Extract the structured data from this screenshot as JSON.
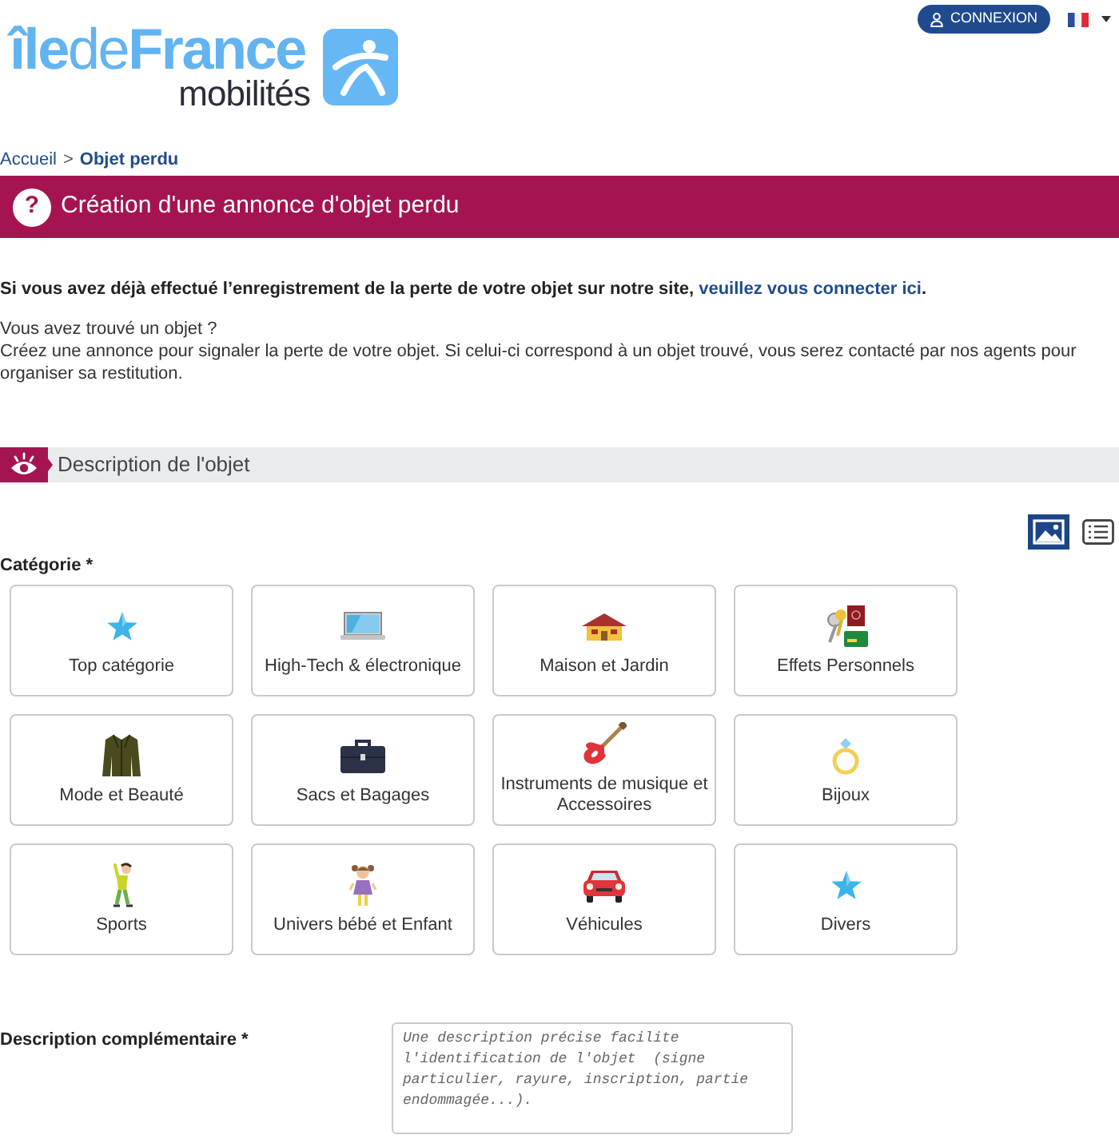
{
  "header": {
    "logo": {
      "wordmark": "**île**de**France**",
      "tagline": "mobilités"
    },
    "login_button": "CONNEXION"
  },
  "breadcrumb": {
    "separator": ">",
    "items": [
      {
        "label": "Accueil",
        "current": false
      },
      {
        "label": "Objet perdu",
        "current": true
      }
    ]
  },
  "banner": {
    "icon": "?",
    "title": "Création d'une annonce d'objet perdu"
  },
  "intro": {
    "notice": "Si vous avez déjà effectué l’enregistrement de la perte de votre objet sur notre site,",
    "notice_link": "veuillez vous connecter ici",
    "notice_end": ".",
    "found_question": "Vous avez trouvé un objet ?",
    "found_text": "Créez une annonce pour signaler la perte de votre objet. Si celui-ci correspond à un objet trouvé, vous serez contacté par nos agents pour organiser sa restitution."
  },
  "section": {
    "title": "Description de l'objet"
  },
  "view_toggle": [
    {
      "kind": "gallery",
      "selected": true
    },
    {
      "kind": "list",
      "selected": false
    }
  ],
  "category": {
    "label": "Catégorie *",
    "items": [
      {
        "label": "Top catégorie",
        "kind": "star"
      },
      {
        "label": "High-Tech & électronique",
        "kind": "laptop"
      },
      {
        "label": "Maison et Jardin",
        "kind": "house"
      },
      {
        "label": "Effets Personnels",
        "kind": "keys"
      },
      {
        "label": "Mode et Beauté",
        "kind": "jacket"
      },
      {
        "label": "Sacs et Bagages",
        "kind": "briefcase"
      },
      {
        "label": "Instruments de musique et Accessoires",
        "kind": "guitar"
      },
      {
        "label": "Bijoux",
        "kind": "ring"
      },
      {
        "label": "Sports",
        "kind": "athlete"
      },
      {
        "label": "Univers bébé et Enfant",
        "kind": "child"
      },
      {
        "label": "Véhicules",
        "kind": "car"
      },
      {
        "label": "Divers",
        "kind": "star"
      }
    ]
  },
  "description": {
    "label": "Description complémentaire *",
    "placeholder": "Une description précise facilite l'identification de l'objet  (signe particulier, rayure, inscription, partie endommagée...)."
  }
}
